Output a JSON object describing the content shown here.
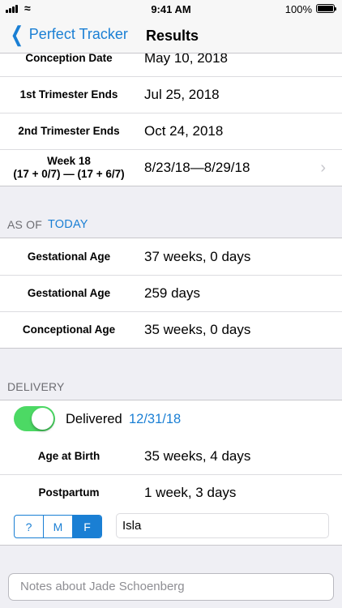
{
  "status_bar": {
    "time": "9:41 AM",
    "battery": "100%",
    "signal_icon": "signal-icon",
    "wifi_icon": "wifi-icon",
    "battery_icon": "battery-icon"
  },
  "nav": {
    "back_label": "Perfect Tracker",
    "back_icon": "chevron-left-icon",
    "title": "Results"
  },
  "milestones": [
    {
      "label": "Conception Date",
      "value": "May 10, 2018"
    },
    {
      "label": "1st Trimester Ends",
      "value": "Jul 25, 2018"
    },
    {
      "label": "2nd Trimester Ends",
      "value": "Oct 24, 2018"
    }
  ],
  "week_row": {
    "label_line1": "Week 18",
    "label_line2": "(17 + 0/7) — (17 + 6/7)",
    "value": "8/23/18—8/29/18",
    "disclosure_icon": "chevron-right-icon"
  },
  "as_of": {
    "header": "AS OF",
    "today_label": "TODAY",
    "rows": [
      {
        "label": "Gestational Age",
        "value": "37 weeks, 0 days"
      },
      {
        "label": "Gestational Age",
        "value": "259 days"
      },
      {
        "label": "Conceptional Age",
        "value": "35 weeks, 0 days"
      }
    ]
  },
  "delivery": {
    "header": "DELIVERY",
    "delivered_label": "Delivered",
    "delivered_on": true,
    "delivery_date": "12/31/18",
    "rows": [
      {
        "label": "Age at Birth",
        "value": "35 weeks, 4 days"
      },
      {
        "label": "Postpartum",
        "value": "1 week, 3 days"
      }
    ],
    "sex_options": [
      "?",
      "M",
      "F"
    ],
    "selected_sex": "F",
    "baby_name": "Isla"
  },
  "notes": {
    "placeholder": "Notes about Jade Schoenberg"
  },
  "colors": {
    "accent": "#1a7fd4",
    "switch_on": "#4cd964",
    "background": "#efeff4"
  }
}
